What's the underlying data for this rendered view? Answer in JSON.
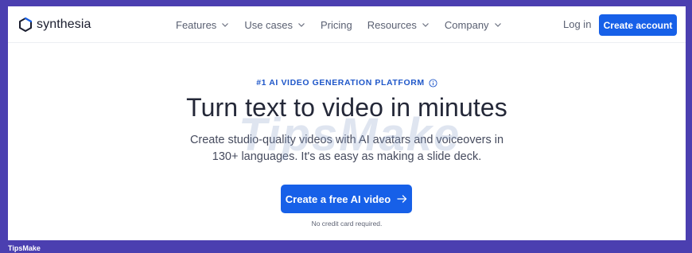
{
  "brand": {
    "name": "synthesia"
  },
  "nav": {
    "items": [
      {
        "label": "Features",
        "has_dropdown": true
      },
      {
        "label": "Use cases",
        "has_dropdown": true
      },
      {
        "label": "Pricing",
        "has_dropdown": false
      },
      {
        "label": "Resources",
        "has_dropdown": true
      },
      {
        "label": "Company",
        "has_dropdown": true
      }
    ],
    "login_label": "Log in",
    "cta_label": "Create account"
  },
  "hero": {
    "eyebrow": "#1 AI VIDEO GENERATION PLATFORM",
    "headline": "Turn text to video in minutes",
    "subtitle_line1": "Create studio-quality videos with AI avatars and voiceovers in",
    "subtitle_line2": "130+ languages. It's as easy as making a slide deck.",
    "cta_label": "Create a free AI video",
    "note": "No credit card required."
  },
  "watermark": {
    "text": "TipsMake"
  },
  "footer_bar": {
    "label": "TipsMake"
  },
  "colors": {
    "accent": "#1760e8",
    "eyebrow": "#1f57c9",
    "frame_border": "#4b3fb0"
  }
}
